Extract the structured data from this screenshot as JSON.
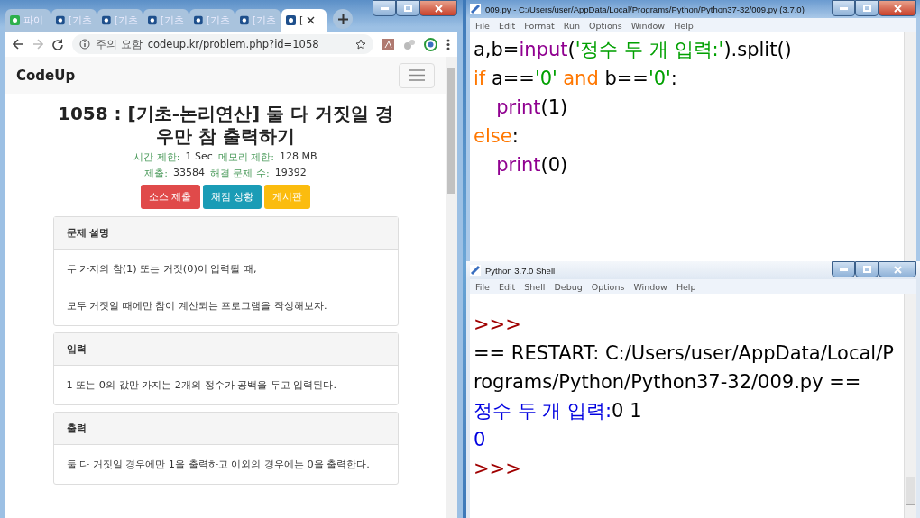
{
  "browser": {
    "tabs": [
      {
        "label": "파이",
        "kind": "app",
        "selected": false
      },
      {
        "label": "[기초",
        "kind": "site",
        "selected": false
      },
      {
        "label": "[기초",
        "kind": "site",
        "selected": false
      },
      {
        "label": "[기초",
        "kind": "site",
        "selected": false
      },
      {
        "label": "[기초",
        "kind": "site",
        "selected": false
      },
      {
        "label": "[기초",
        "kind": "site",
        "selected": false
      },
      {
        "label": "[",
        "kind": "site",
        "selected": true
      }
    ],
    "security": "주의 요함",
    "url": "codeup.kr/problem.php?id=1058",
    "brand": "CodeUp",
    "problem": {
      "title": "1058 : [기초-논리연산] 둘 다 거짓일 경우만 참 출력하기",
      "meta": [
        [
          {
            "label": "시간 제한:",
            "value": "1 Sec"
          },
          {
            "label": "메모리 제한:",
            "value": "128 MB"
          }
        ],
        [
          {
            "label": "제출:",
            "value": "33584"
          },
          {
            "label": "해결 문제 수:",
            "value": "19392"
          }
        ]
      ],
      "buttons": [
        {
          "label": "소스 제출",
          "color": "#e04a4a"
        },
        {
          "label": "채점 상황",
          "color": "#1a9cb6"
        },
        {
          "label": "게시판",
          "color": "#fbbc0e"
        }
      ],
      "sections": [
        {
          "heading": "문제 설명",
          "paragraphs": [
            "두 가지의 참(1) 또는 거짓(0)이 입력될 때,",
            "모두 거짓일 때에만 참이 계산되는 프로그램을 작성해보자."
          ]
        },
        {
          "heading": "입력",
          "paragraphs": [
            "1 또는 0의 값만 가지는 2개의 정수가 공백을 두고 입력된다."
          ]
        },
        {
          "heading": "출력",
          "paragraphs": [
            "둘 다 거짓일 경우에만 1을 출력하고 이외의 경우에는 0을 출력한다."
          ]
        }
      ]
    }
  },
  "editor": {
    "title": "009.py - C:/Users/user/AppData/Local/Programs/Python/Python37-32/009.py (3.7.0)",
    "menu": [
      "File",
      "Edit",
      "Format",
      "Run",
      "Options",
      "Window",
      "Help"
    ],
    "lines": [
      [
        {
          "kind": "plain",
          "text": "a,b="
        },
        {
          "kind": "builtin",
          "text": "input"
        },
        {
          "kind": "plain",
          "text": "("
        },
        {
          "kind": "string",
          "text": "'정수 두 개 입력:'"
        },
        {
          "kind": "plain",
          "text": ").split()"
        }
      ],
      [
        {
          "kind": "keyword",
          "text": "if"
        },
        {
          "kind": "plain",
          "text": " a=="
        },
        {
          "kind": "string",
          "text": "'0'"
        },
        {
          "kind": "space"
        },
        {
          "kind": "keyword",
          "text": "and"
        },
        {
          "kind": "plain",
          "text": " b=="
        },
        {
          "kind": "string",
          "text": "'0'"
        },
        {
          "kind": "plain",
          "text": ":"
        }
      ],
      [
        {
          "kind": "indent"
        },
        {
          "kind": "builtin",
          "text": "print"
        },
        {
          "kind": "plain",
          "text": "(1)"
        }
      ],
      [
        {
          "kind": "keyword",
          "text": "else"
        },
        {
          "kind": "plain",
          "text": ":"
        }
      ],
      [
        {
          "kind": "indent"
        },
        {
          "kind": "builtin",
          "text": "print"
        },
        {
          "kind": "plain",
          "text": "(0)"
        }
      ]
    ]
  },
  "shell": {
    "title": "Python 3.7.0 Shell",
    "menu": [
      "File",
      "Edit",
      "Shell",
      "Debug",
      "Options",
      "Window",
      "Help"
    ],
    "lines": [
      [
        {
          "kind": "prompt",
          "text": ">>>"
        }
      ],
      [
        {
          "kind": "plain",
          "text": "== RESTART: C:/Users/user/AppData/Local/Programs/Python/Python37-32/009.py =="
        }
      ],
      [
        {
          "kind": "output",
          "text": "정수 두 개 입력:"
        },
        {
          "kind": "plain",
          "text": "0 1"
        }
      ],
      [
        {
          "kind": "output",
          "text": "0"
        }
      ],
      [
        {
          "kind": "prompt",
          "text": ">>>"
        }
      ]
    ]
  }
}
